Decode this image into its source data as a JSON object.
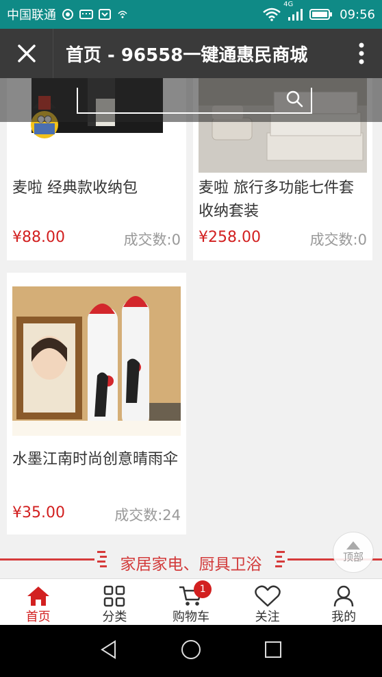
{
  "status_bar": {
    "carrier": "中国联通",
    "network": "4G",
    "time": "09:56"
  },
  "title_bar": {
    "title": "首页 - 96558一键通惠民商城"
  },
  "search": {
    "placeholder": ""
  },
  "products": [
    {
      "name": "麦啦 经典款收纳包",
      "price": "¥88.00",
      "sales": "成交数:0"
    },
    {
      "name": "麦啦 旅行多功能七件套收纳套装",
      "price": "¥258.00",
      "sales": "成交数:0"
    },
    {
      "name": "水墨江南时尚创意晴雨伞",
      "price": "¥35.00",
      "sales": "成交数:24"
    }
  ],
  "section": {
    "title": "家居家电、厨具卫浴"
  },
  "back_to_top": {
    "label": "顶部"
  },
  "tabbar": {
    "items": [
      {
        "label": "首页",
        "icon": "home-icon",
        "active": true
      },
      {
        "label": "分类",
        "icon": "category-icon",
        "active": false
      },
      {
        "label": "购物车",
        "icon": "cart-icon",
        "active": false,
        "badge": "1"
      },
      {
        "label": "关注",
        "icon": "heart-icon",
        "active": false
      },
      {
        "label": "我的",
        "icon": "user-icon",
        "active": false
      }
    ]
  },
  "colors": {
    "status_bar": "#0f8a86",
    "title_bar": "#3a3a3a",
    "accent": "#d22020"
  }
}
